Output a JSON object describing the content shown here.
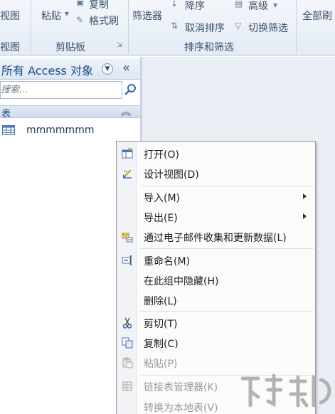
{
  "ribbon": {
    "view_label": "视图",
    "view_group": "视图",
    "paste_label": "粘贴",
    "copy_label": "复制",
    "format_painter_label": "格式刷",
    "clipboard_group": "剪贴板",
    "filter_label": "筛选器",
    "descending_label": "降序",
    "remove_sort_label": "取消排序",
    "advanced_label": "高级",
    "toggle_filter_label": "切换筛选",
    "sort_filter_group": "排序和筛选",
    "refresh_all_label": "全部刷"
  },
  "nav_pane": {
    "title": "所有 Access 对象",
    "search_placeholder": "搜索...",
    "group_label": "表",
    "table_name": "mmmmmmm"
  },
  "context_menu": {
    "items": [
      {
        "label": "打开(O)",
        "icon": "open-icon"
      },
      {
        "label": "设计视图(D)",
        "icon": "design-view-icon"
      },
      {
        "label": "导入(M)"
      },
      {
        "label": "导出(E)"
      },
      {
        "label": "通过电子邮件收集和更新数据(L)",
        "icon": "email-collect-icon"
      },
      {
        "label": "重命名(M)",
        "icon": "rename-icon"
      },
      {
        "label": "在此组中隐藏(H)"
      },
      {
        "label": "删除(L)"
      },
      {
        "label": "剪切(T)",
        "icon": "cut-icon"
      },
      {
        "label": "复制(C)",
        "icon": "copy-icon"
      },
      {
        "label": "粘贴(P)",
        "icon": "paste-icon"
      },
      {
        "label": "链接表管理器(K)",
        "icon": "linked-table-manager-icon"
      },
      {
        "label": "转换为本地表(V)"
      }
    ]
  },
  "colors": {
    "ribbon_bg": "#e4ebf5",
    "nav_title": "#1e4a8a",
    "workspace_bg": "#e9eef5",
    "menu_bg": "#fbfbfb",
    "disabled_text": "#9a9a9a"
  }
}
